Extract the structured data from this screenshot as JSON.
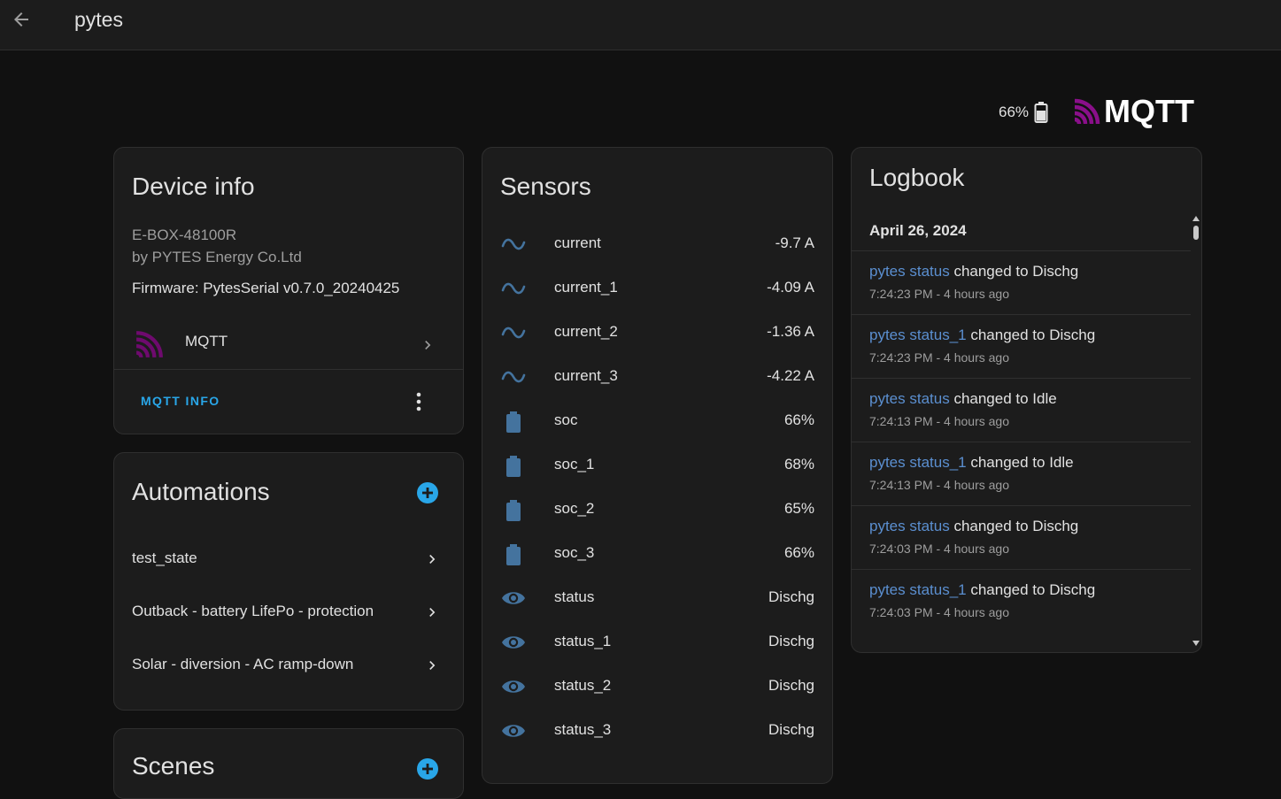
{
  "header": {
    "title": "pytes"
  },
  "status": {
    "battery_percent": "66%"
  },
  "brand": {
    "logo_text": "MQTT",
    "accent": "#660066"
  },
  "device": {
    "title": "Device info",
    "model": "E-BOX-48100R",
    "manufacturer": "by PYTES Energy Co.Ltd",
    "firmware": "Firmware: PytesSerial v0.7.0_20240425",
    "integration_label": "MQTT",
    "action_label": "MQTT INFO"
  },
  "automations": {
    "title": "Automations",
    "items": [
      {
        "label": "test_state"
      },
      {
        "label": "Outback - battery LifePo - protection"
      },
      {
        "label": "Solar - diversion - AC ramp-down"
      }
    ]
  },
  "scenes": {
    "title": "Scenes"
  },
  "sensors": {
    "title": "Sensors",
    "items": [
      {
        "icon": "current-ac-icon",
        "name": "current",
        "value": "-9.7 A"
      },
      {
        "icon": "current-ac-icon",
        "name": "current_1",
        "value": "-4.09 A"
      },
      {
        "icon": "current-ac-icon",
        "name": "current_2",
        "value": "-1.36 A"
      },
      {
        "icon": "current-ac-icon",
        "name": "current_3",
        "value": "-4.22 A"
      },
      {
        "icon": "battery-icon",
        "name": "soc",
        "value": "66%"
      },
      {
        "icon": "battery-icon",
        "name": "soc_1",
        "value": "68%"
      },
      {
        "icon": "battery-icon",
        "name": "soc_2",
        "value": "65%"
      },
      {
        "icon": "battery-icon",
        "name": "soc_3",
        "value": "66%"
      },
      {
        "icon": "eye-icon",
        "name": "status",
        "value": "Dischg"
      },
      {
        "icon": "eye-icon",
        "name": "status_1",
        "value": "Dischg"
      },
      {
        "icon": "eye-icon",
        "name": "status_2",
        "value": "Dischg"
      },
      {
        "icon": "eye-icon",
        "name": "status_3",
        "value": "Dischg"
      }
    ]
  },
  "logbook": {
    "title": "Logbook",
    "date": "April 26, 2024",
    "entries": [
      {
        "entity": "pytes status",
        "message": " changed to Dischg",
        "time": "7:24:23 PM - 4 hours ago"
      },
      {
        "entity": "pytes status_1",
        "message": " changed to Dischg",
        "time": "7:24:23 PM - 4 hours ago"
      },
      {
        "entity": "pytes status",
        "message": " changed to Idle",
        "time": "7:24:13 PM - 4 hours ago"
      },
      {
        "entity": "pytes status_1",
        "message": " changed to Idle",
        "time": "7:24:13 PM - 4 hours ago"
      },
      {
        "entity": "pytes status",
        "message": " changed to Dischg",
        "time": "7:24:03 PM - 4 hours ago"
      },
      {
        "entity": "pytes status_1",
        "message": " changed to Dischg",
        "time": "7:24:03 PM - 4 hours ago"
      }
    ]
  },
  "colors": {
    "background": "#111111",
    "card": "#1c1c1c",
    "primary": "#29a6e8",
    "sensor_icon": "#44739e",
    "link": "#5b8fd0"
  }
}
